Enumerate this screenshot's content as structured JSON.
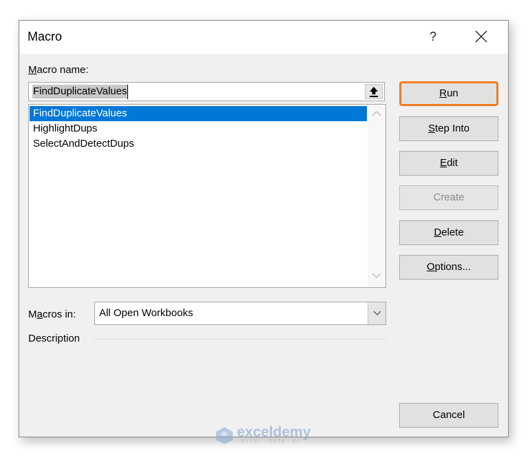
{
  "dialog": {
    "title": "Macro",
    "help_label": "?",
    "close_icon": "close-icon"
  },
  "macro_name": {
    "label_prefix_underlined": "M",
    "label_rest": "acro name:",
    "value": "FindDuplicateValues"
  },
  "macro_list": {
    "items": [
      {
        "label": "FindDuplicateValues",
        "selected": true
      },
      {
        "label": "HighlightDups",
        "selected": false
      },
      {
        "label": "SelectAndDetectDups",
        "selected": false
      }
    ]
  },
  "buttons": {
    "run": {
      "u": "R",
      "rest": "un",
      "enabled": true,
      "default": true
    },
    "step_into": {
      "u": "S",
      "rest": "tep Into",
      "enabled": true
    },
    "edit": {
      "u": "E",
      "rest": "dit",
      "enabled": true
    },
    "create": {
      "label": "Create",
      "enabled": false
    },
    "delete": {
      "u": "D",
      "rest": "elete",
      "enabled": true
    },
    "options": {
      "u": "O",
      "rest": "ptions...",
      "enabled": true
    },
    "cancel": {
      "label": "Cancel",
      "enabled": true
    }
  },
  "macros_in": {
    "label_a": "M",
    "label_u": "a",
    "label_rest": "cros in:",
    "selected": "All Open Workbooks"
  },
  "description": {
    "label": "Description",
    "text": ""
  },
  "watermark": {
    "brand": "exceldemy",
    "tagline": "EXCEL · DATA · BI"
  },
  "colors": {
    "selection": "#0078d7",
    "default_button_outline": "#f07c22",
    "dialog_bg": "#f0f0f0"
  }
}
